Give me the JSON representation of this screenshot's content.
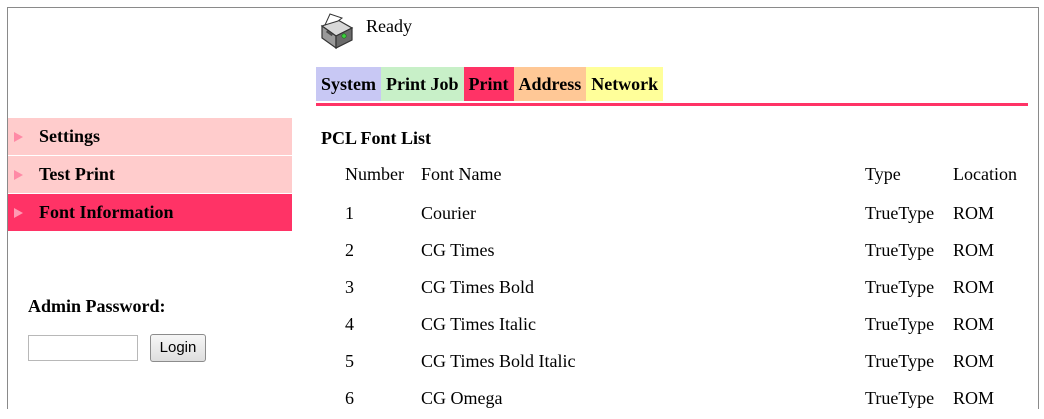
{
  "status": {
    "icon": "printer-icon",
    "text": "Ready"
  },
  "tabs": [
    {
      "label": "System",
      "color": "#c8c8f4"
    },
    {
      "label": "Print Job",
      "color": "#c8f0c8"
    },
    {
      "label": "Print",
      "color": "#ff3366",
      "active": true
    },
    {
      "label": "Address",
      "color": "#ffc896"
    },
    {
      "label": "Network",
      "color": "#ffff9a"
    }
  ],
  "sidebar": {
    "items": [
      {
        "label": "Settings",
        "active": false
      },
      {
        "label": "Test Print",
        "active": false
      },
      {
        "label": "Font Information",
        "active": true
      }
    ]
  },
  "admin": {
    "label": "Admin Password:",
    "password_value": "",
    "login_label": "Login"
  },
  "content": {
    "title": "PCL Font List",
    "columns": [
      "Number",
      "Font Name",
      "Type",
      "Location"
    ],
    "rows": [
      {
        "number": "1",
        "name": "Courier",
        "type": "TrueType",
        "location": "ROM"
      },
      {
        "number": "2",
        "name": "CG Times",
        "type": "TrueType",
        "location": "ROM"
      },
      {
        "number": "3",
        "name": "CG Times Bold",
        "type": "TrueType",
        "location": "ROM"
      },
      {
        "number": "4",
        "name": "CG Times Italic",
        "type": "TrueType",
        "location": "ROM"
      },
      {
        "number": "5",
        "name": "CG Times Bold Italic",
        "type": "TrueType",
        "location": "ROM"
      },
      {
        "number": "6",
        "name": "CG Omega",
        "type": "TrueType",
        "location": "ROM"
      }
    ]
  },
  "colors": {
    "accent": "#ff3366",
    "sidebar_inactive": "#ffcccc"
  }
}
